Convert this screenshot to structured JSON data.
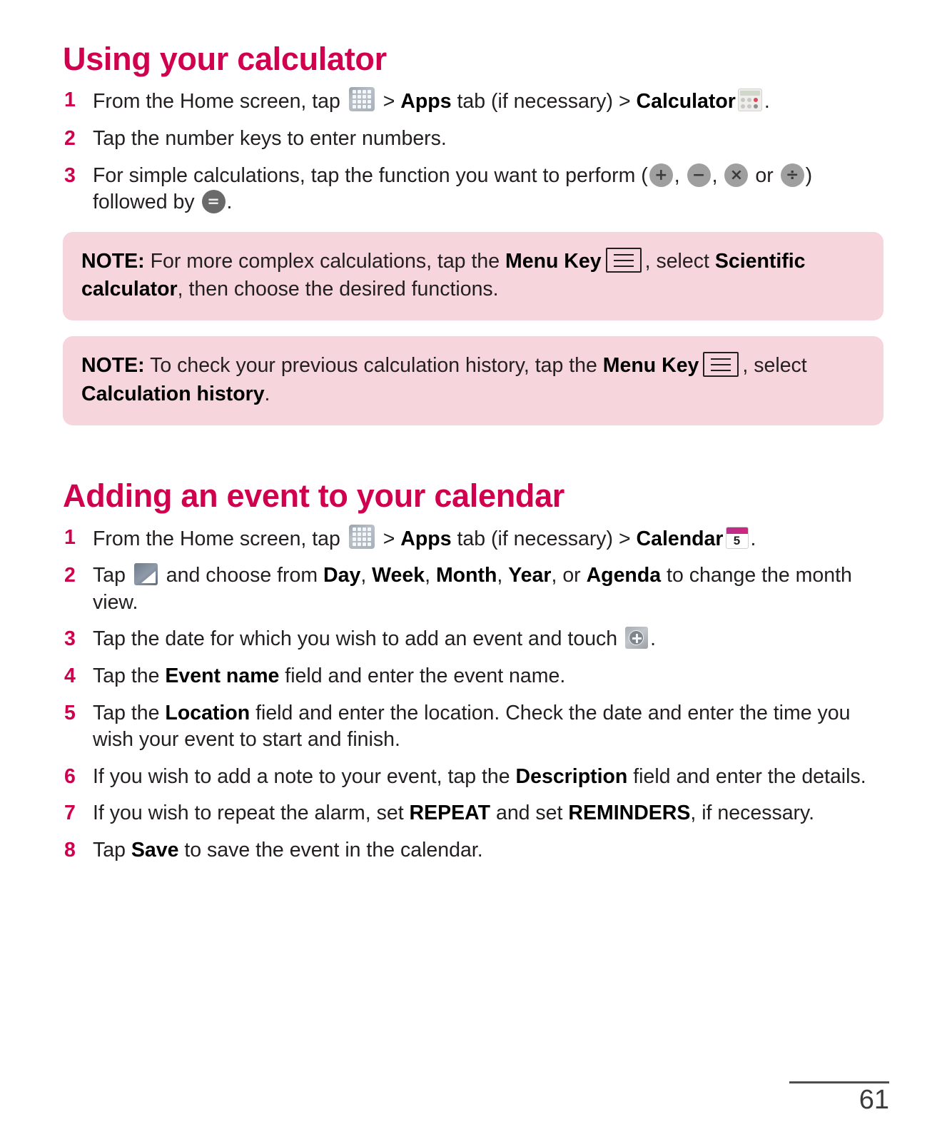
{
  "page": {
    "number": "61"
  },
  "sections": [
    {
      "id": "calculator",
      "title": "Using your calculator",
      "steps": [
        {
          "num": "1",
          "parts": [
            {
              "t": "text",
              "v": "From the Home screen, tap "
            },
            {
              "t": "icon",
              "v": "apps-grid-icon"
            },
            {
              "t": "text",
              "v": " > "
            },
            {
              "t": "bold",
              "v": "Apps"
            },
            {
              "t": "text",
              "v": " tab (if necessary) > "
            },
            {
              "t": "bold",
              "v": "Calculator"
            },
            {
              "t": "icon",
              "v": "calculator-app-icon"
            },
            {
              "t": "text",
              "v": "."
            }
          ]
        },
        {
          "num": "2",
          "parts": [
            {
              "t": "text",
              "v": "Tap the number keys to enter numbers."
            }
          ]
        },
        {
          "num": "3",
          "parts": [
            {
              "t": "text",
              "v": "For simple calculations, tap the function you want to perform ("
            },
            {
              "t": "icon",
              "v": "plus-button-icon"
            },
            {
              "t": "text",
              "v": ", "
            },
            {
              "t": "icon",
              "v": "minus-button-icon"
            },
            {
              "t": "text",
              "v": ", "
            },
            {
              "t": "icon",
              "v": "multiply-button-icon"
            },
            {
              "t": "text",
              "v": " or "
            },
            {
              "t": "icon",
              "v": "divide-button-icon"
            },
            {
              "t": "text",
              "v": ") followed by "
            },
            {
              "t": "icon",
              "v": "equals-button-icon"
            },
            {
              "t": "text",
              "v": "."
            }
          ]
        }
      ],
      "notes": [
        {
          "label": "NOTE:",
          "parts": [
            {
              "t": "text",
              "v": " For more complex calculations, tap the "
            },
            {
              "t": "bold",
              "v": "Menu Key"
            },
            {
              "t": "icon",
              "v": "menu-key-icon"
            },
            {
              "t": "text",
              "v": ", select "
            },
            {
              "t": "bold",
              "v": "Scientific calculator"
            },
            {
              "t": "text",
              "v": ", then choose the desired functions."
            }
          ]
        },
        {
          "label": "NOTE:",
          "parts": [
            {
              "t": "text",
              "v": " To check your previous calculation history, tap the "
            },
            {
              "t": "bold",
              "v": "Menu Key"
            },
            {
              "t": "icon",
              "v": "menu-key-icon"
            },
            {
              "t": "text",
              "v": ", select "
            },
            {
              "t": "bold",
              "v": "Calculation history"
            },
            {
              "t": "text",
              "v": "."
            }
          ]
        }
      ]
    },
    {
      "id": "calendar",
      "title": "Adding an event to your calendar",
      "steps": [
        {
          "num": "1",
          "parts": [
            {
              "t": "text",
              "v": "From the Home screen, tap "
            },
            {
              "t": "icon",
              "v": "apps-grid-icon"
            },
            {
              "t": "text",
              "v": " > "
            },
            {
              "t": "bold",
              "v": "Apps"
            },
            {
              "t": "text",
              "v": " tab (if necessary) > "
            },
            {
              "t": "bold",
              "v": "Calendar"
            },
            {
              "t": "icon",
              "v": "calendar-app-icon"
            },
            {
              "t": "text",
              "v": "."
            }
          ]
        },
        {
          "num": "2",
          "parts": [
            {
              "t": "text",
              "v": "Tap "
            },
            {
              "t": "icon",
              "v": "calendar-view-switch-icon"
            },
            {
              "t": "text",
              "v": " and choose from "
            },
            {
              "t": "bold",
              "v": "Day"
            },
            {
              "t": "text",
              "v": ", "
            },
            {
              "t": "bold",
              "v": "Week"
            },
            {
              "t": "text",
              "v": ", "
            },
            {
              "t": "bold",
              "v": "Month"
            },
            {
              "t": "text",
              "v": ", "
            },
            {
              "t": "bold",
              "v": "Year"
            },
            {
              "t": "text",
              "v": ", or "
            },
            {
              "t": "bold",
              "v": "Agenda"
            },
            {
              "t": "text",
              "v": " to change the month view."
            }
          ]
        },
        {
          "num": "3",
          "parts": [
            {
              "t": "text",
              "v": "Tap the date for which you wish to add an event and touch "
            },
            {
              "t": "icon",
              "v": "add-event-icon"
            },
            {
              "t": "text",
              "v": "."
            }
          ]
        },
        {
          "num": "4",
          "parts": [
            {
              "t": "text",
              "v": "Tap the "
            },
            {
              "t": "bold",
              "v": "Event name"
            },
            {
              "t": "text",
              "v": " field and enter the event name."
            }
          ]
        },
        {
          "num": "5",
          "parts": [
            {
              "t": "text",
              "v": "Tap the "
            },
            {
              "t": "bold",
              "v": "Location"
            },
            {
              "t": "text",
              "v": " field and enter the location. Check the date and enter the time you wish your event to start and finish."
            }
          ]
        },
        {
          "num": "6",
          "parts": [
            {
              "t": "text",
              "v": "If you wish to add a note to your event, tap the "
            },
            {
              "t": "bold",
              "v": "Description"
            },
            {
              "t": "text",
              "v": " field and enter the details."
            }
          ]
        },
        {
          "num": "7",
          "parts": [
            {
              "t": "text",
              "v": "If you wish to repeat the alarm, set "
            },
            {
              "t": "bold",
              "v": "REPEAT"
            },
            {
              "t": "text",
              "v": " and set "
            },
            {
              "t": "bold",
              "v": "REMINDERS"
            },
            {
              "t": "text",
              "v": ", if necessary."
            }
          ]
        },
        {
          "num": "8",
          "parts": [
            {
              "t": "text",
              "v": "Tap "
            },
            {
              "t": "bold",
              "v": "Save"
            },
            {
              "t": "text",
              "v": " to save the event in the calendar."
            }
          ]
        }
      ],
      "notes": []
    }
  ],
  "icons": {
    "calendar-app-icon": {
      "day_label": "5"
    },
    "plus-button-icon": {
      "glyph": "+"
    },
    "minus-button-icon": {
      "glyph": "−"
    },
    "multiply-button-icon": {
      "glyph": "×"
    },
    "divide-button-icon": {
      "glyph": "÷"
    },
    "equals-button-icon": {
      "glyph": "="
    }
  },
  "colors": {
    "heading": "#D1004F",
    "step_number": "#D1004F",
    "note_background": "#F7D5DC",
    "body_text": "#231F20"
  }
}
